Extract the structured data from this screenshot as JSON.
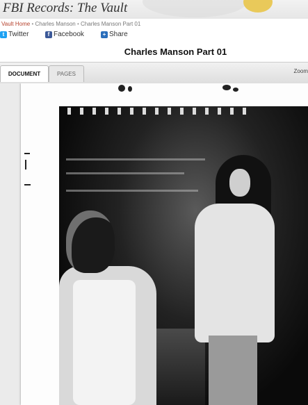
{
  "header": {
    "site_title": "FBI Records: The Vault"
  },
  "breadcrumb": {
    "home": "Vault Home",
    "sep": "•",
    "level1": "Charles Manson",
    "level2": "Charles Manson Part 01"
  },
  "share": {
    "twitter": "Twitter",
    "facebook": "Facebook",
    "share": "Share"
  },
  "document": {
    "title": "Charles Manson Part 01"
  },
  "tabs": {
    "document": "DOCUMENT",
    "pages": "PAGES"
  },
  "toolbar": {
    "zoom_label": "Zoom"
  },
  "colors": {
    "twitter": "#1da1f2",
    "facebook": "#3b5998",
    "share": "#2a6ebb",
    "link": "#b5402b"
  },
  "icons": {
    "twitter": "twitter-icon",
    "facebook": "facebook-icon",
    "share": "share-plus-icon"
  }
}
